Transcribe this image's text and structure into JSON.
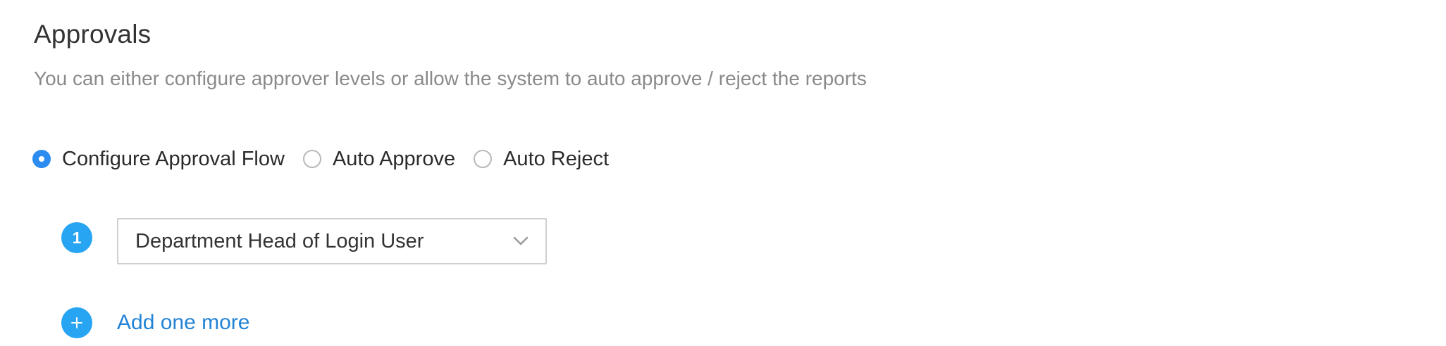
{
  "header": {
    "title": "Approvals",
    "subtitle": "You can either configure approver levels or allow the system to auto approve / reject the reports"
  },
  "approval_mode": {
    "options": [
      {
        "label": "Configure Approval Flow",
        "selected": true
      },
      {
        "label": "Auto Approve",
        "selected": false
      },
      {
        "label": "Auto Reject",
        "selected": false
      }
    ]
  },
  "levels": [
    {
      "number": "1",
      "approver": "Department Head of Login User"
    }
  ],
  "add_level": {
    "label": "Add one more"
  },
  "colors": {
    "accent": "#2d8cf0",
    "badge": "#27a4f2",
    "link": "#2384d6",
    "subtitle": "#8a8a8a",
    "border": "#cfcfcf"
  },
  "icons": {
    "dropdown": "chevron-down-icon",
    "add": "plus-icon"
  }
}
